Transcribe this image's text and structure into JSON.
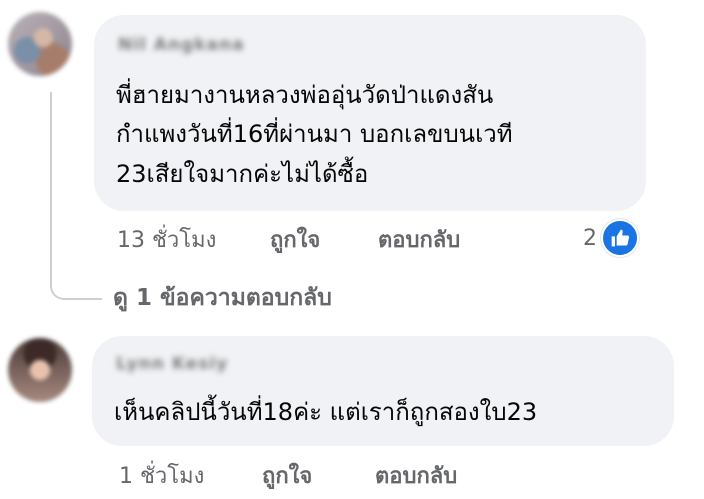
{
  "comments": [
    {
      "author": "Nil Angkana",
      "lines": [
        "พี่ฮายมางานหลวงพ่ออุ่นวัดป่าแดงสัน",
        "กำแพงวันที่16ที่ผ่านมา บอกเลขบนเวที",
        "23เสียใจมากค่ะไม่ได้ซื้อ"
      ],
      "time": "13 ชั่วโมง",
      "like_label": "ถูกใจ",
      "reply_label": "ตอบกลับ",
      "reaction_count": "2",
      "reaction_icon": "like-icon"
    },
    {
      "author": "Lynn Kesiy",
      "lines": [
        "เห็นคลิปนี้วันที่18ค่ะ แต่เราก็ถูกสองใบ23"
      ],
      "time": "1 ชั่วโมง",
      "like_label": "ถูกใจ",
      "reply_label": "ตอบกลับ"
    }
  ],
  "view_replies": "ดู 1 ข้อความตอบกลับ",
  "colors": {
    "bubble": "#f0f2f5",
    "meta_text": "#65676b",
    "like_blue": "#1b74e4"
  }
}
